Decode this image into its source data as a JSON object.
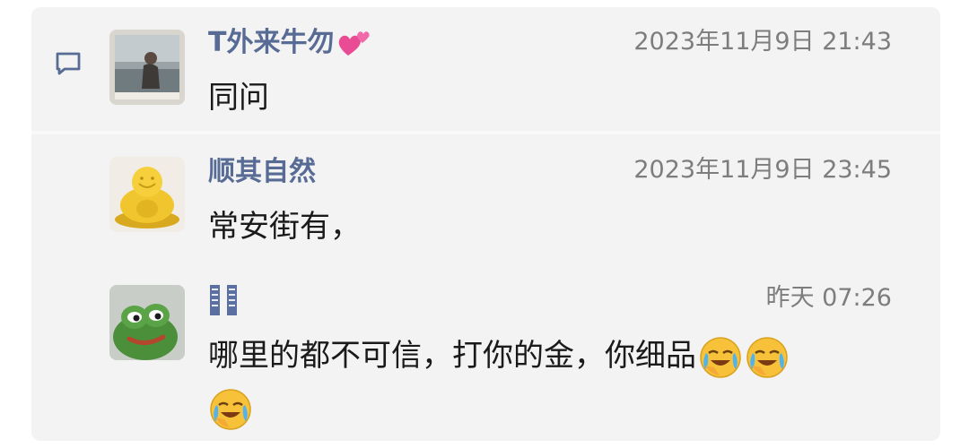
{
  "comments": [
    {
      "user_name": "T外来牛勿",
      "user_emoji": "two-hearts-emoji",
      "timestamp": "2023年11月9日 21:43",
      "text": "同问",
      "avatar_icon": "photo-avatar"
    },
    {
      "user_name": "顺其自然",
      "timestamp": "2023年11月9日 23:45",
      "text": "常安街有，",
      "avatar_icon": "golden-buddha-avatar"
    },
    {
      "user_name": "",
      "user_name_icon": "bookmark-tag-icon",
      "timestamp": "昨天 07:26",
      "text_line1": "哪里的都不可信，打你的金，你细品",
      "text_line2": "",
      "emoji": "face-with-tears-emoji",
      "avatar_icon": "frog-avatar"
    }
  ],
  "colors": {
    "name": "#576b95",
    "time": "#7d7d7d",
    "panel": "#f3f3f3",
    "text": "#1a1a1a"
  }
}
